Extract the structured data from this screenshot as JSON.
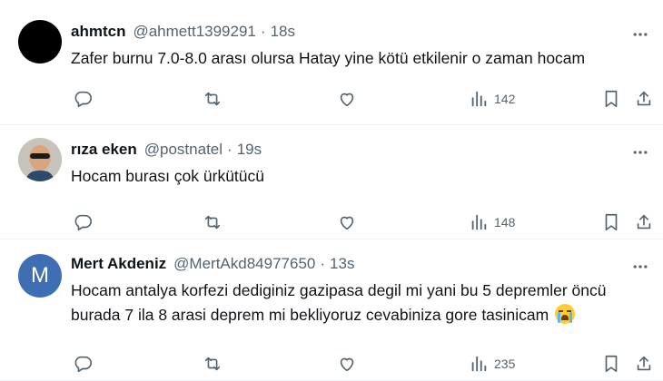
{
  "tweets": [
    {
      "name": "ahmtcn",
      "handle": "@ahmett1399291",
      "time": "18s",
      "text": "Zafer burnu 7.0-8.0 arası olursa Hatay yine kötü etkilenir o zaman hocam",
      "views": "142"
    },
    {
      "name": "rıza eken",
      "handle": "@postnatel",
      "time": "19s",
      "text": "Hocam burası çok ürkütücü",
      "views": "148"
    },
    {
      "name": "Mert Akdeniz",
      "handle": "@MertAkd84977650",
      "time": "13s",
      "avatar_letter": "M",
      "text_line1": "Hocam antalya korfezi dediginiz gazipasa degil mi yani bu 5 depremler öncü",
      "text_line2": "burada 7 ila 8 arasi deprem mi bekliyoruz cevabiniza gore tasinicam",
      "views": "235"
    }
  ],
  "separator": "·",
  "icons": [
    "more-icon",
    "reply-icon",
    "retweet-icon",
    "like-icon",
    "views-icon",
    "bookmark-icon",
    "share-icon",
    "crying-emoji"
  ],
  "colors": {
    "text": "#0f1419",
    "muted": "#536471",
    "border": "#eff3f4",
    "avatar_m": "#3e6fb5"
  }
}
